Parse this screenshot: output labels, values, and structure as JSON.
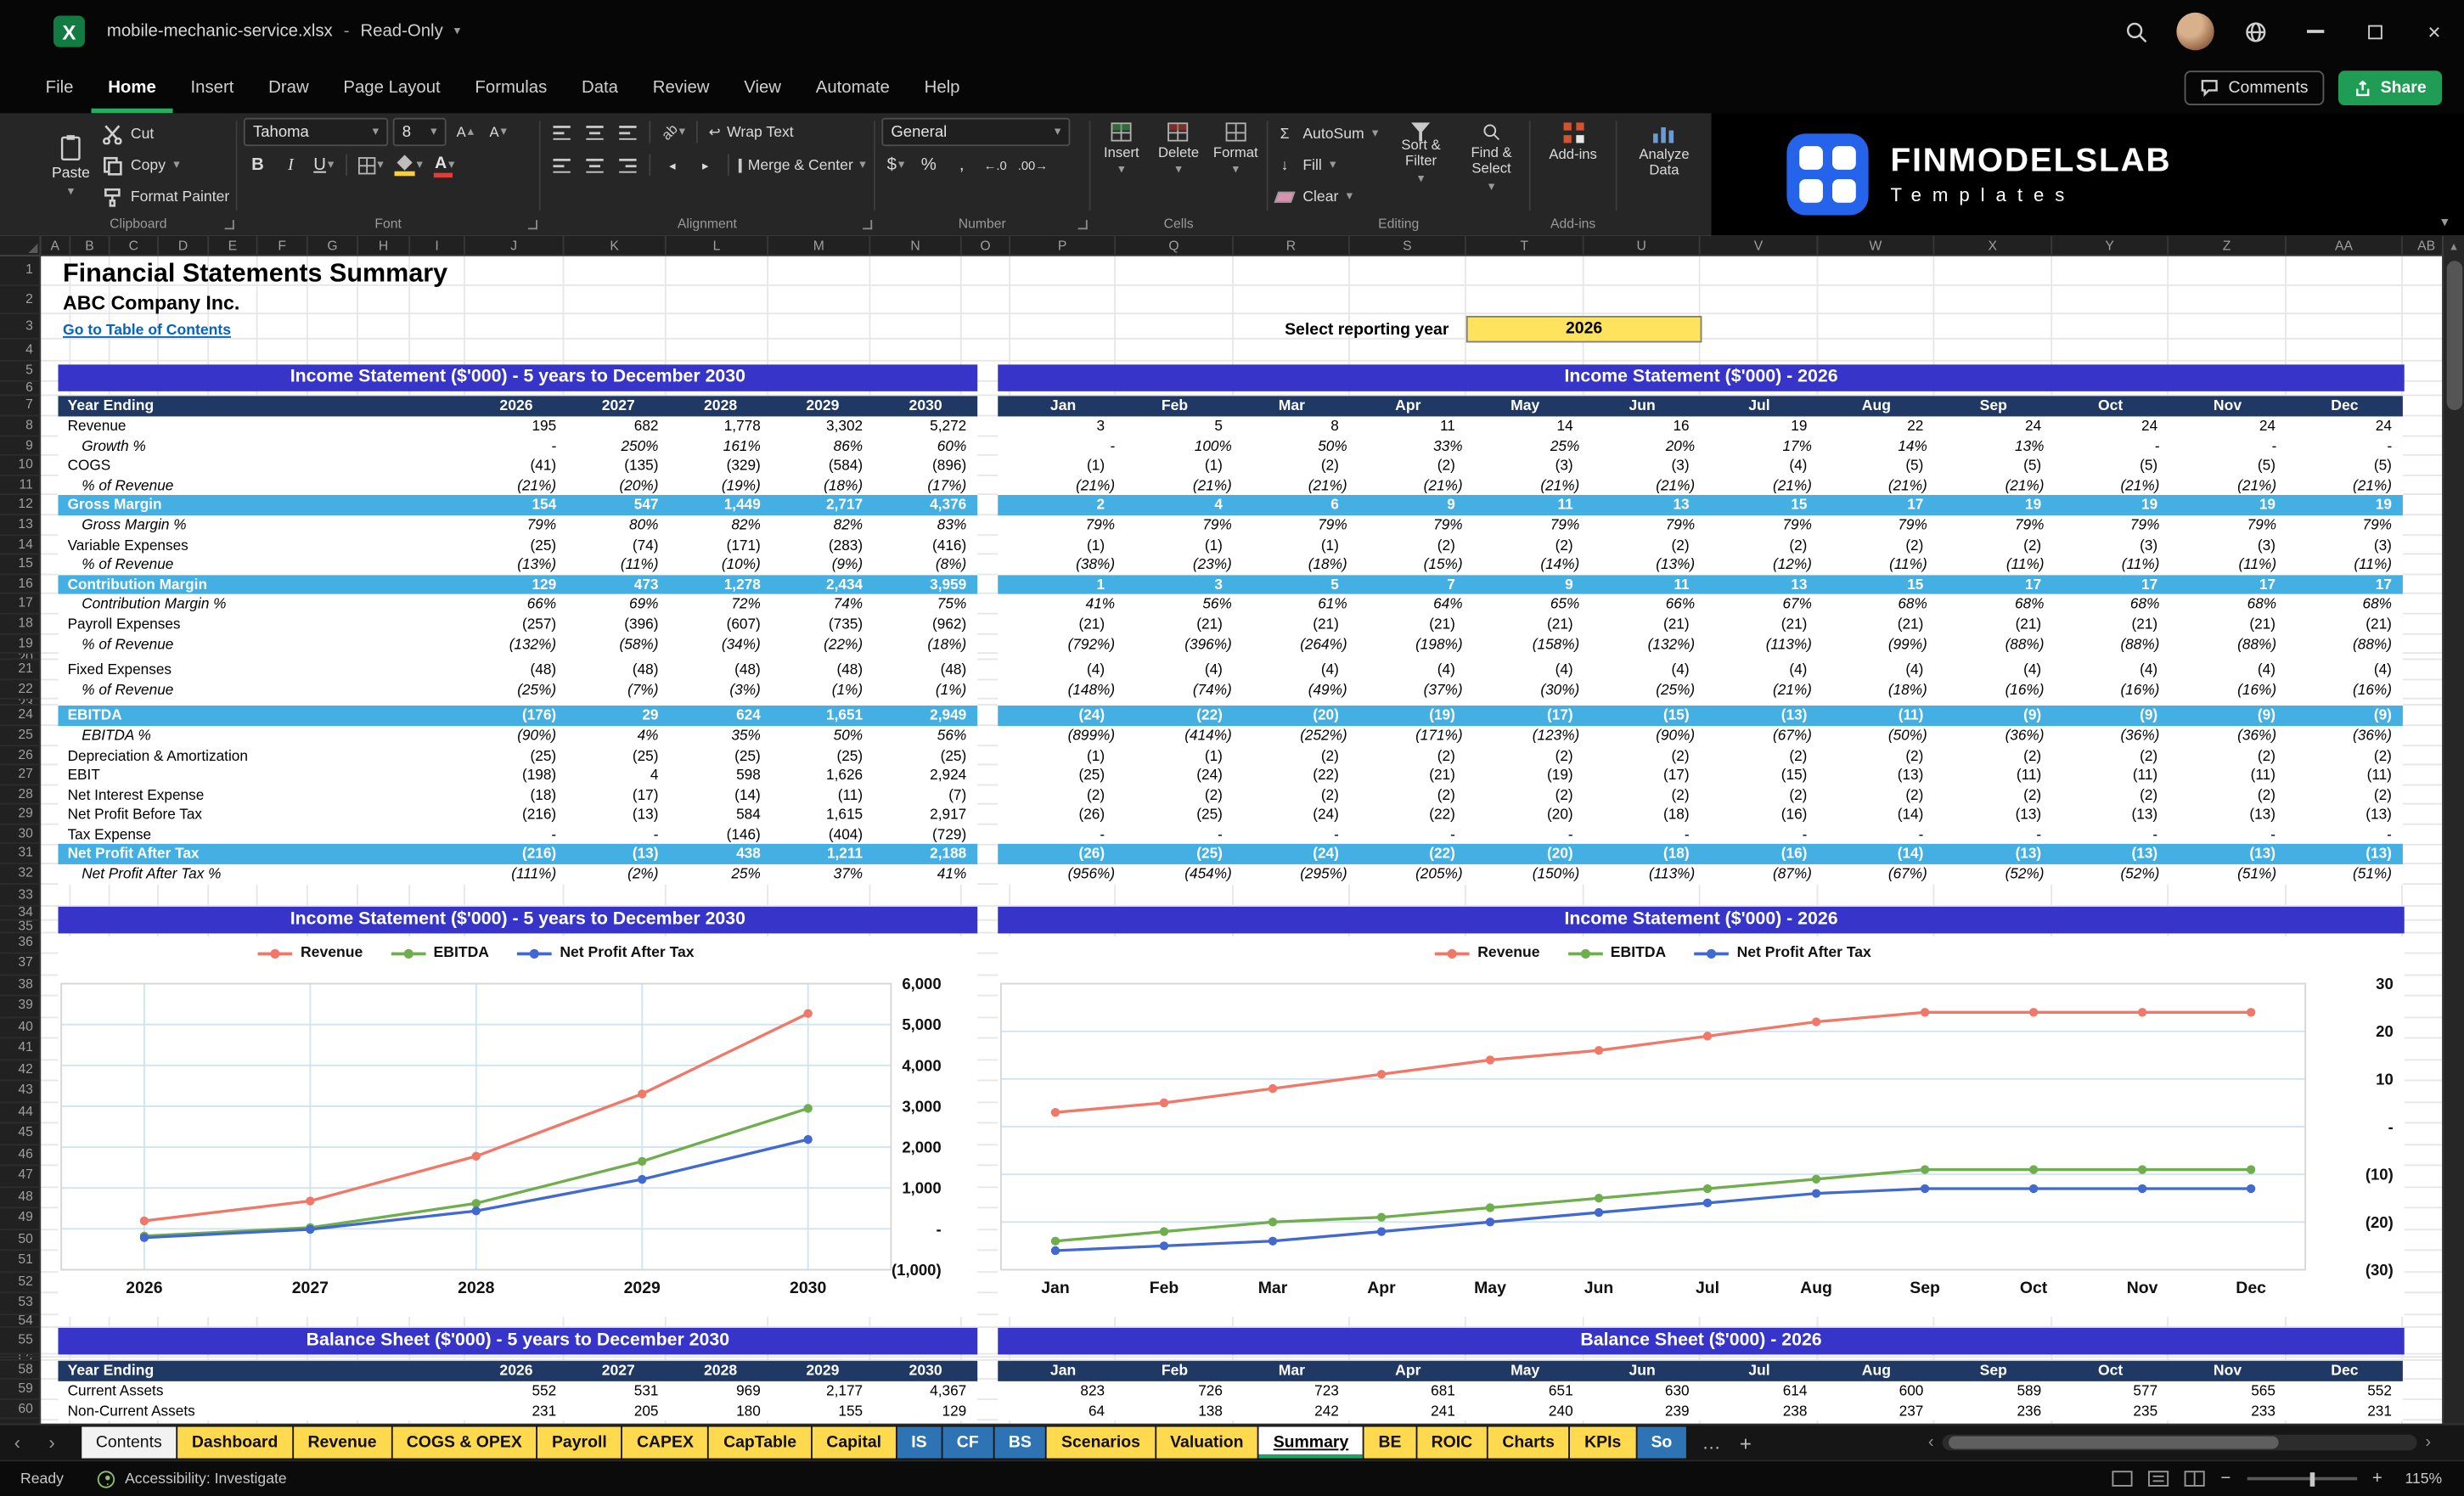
{
  "titlebar": {
    "filename": "mobile-mechanic-service.xlsx",
    "dash": "-",
    "mode": "Read-Only"
  },
  "menu": {
    "tabs": [
      "File",
      "Home",
      "Insert",
      "Draw",
      "Page Layout",
      "Formulas",
      "Data",
      "Review",
      "View",
      "Automate",
      "Help"
    ],
    "active_tab": "Home",
    "comments": "Comments",
    "share": "Share"
  },
  "ribbon": {
    "paste": "Paste",
    "cut": "Cut",
    "copy": "Copy",
    "format_painter": "Format Painter",
    "clipboard": "Clipboard",
    "font_name": "Tahoma",
    "font_size": "8",
    "font": "Font",
    "wrap_text": "Wrap Text",
    "merge_center": "Merge & Center",
    "alignment": "Alignment",
    "number_format": "General",
    "number": "Number",
    "insert": "Insert",
    "delete": "Delete",
    "format": "Format",
    "cells": "Cells",
    "autosum": "AutoSum",
    "fill": "Fill",
    "clear": "Clear",
    "sort_filter": "Sort & Filter",
    "find_select": "Find & Select",
    "editing": "Editing",
    "addins": "Add-ins",
    "analyze": "Analyze Data"
  },
  "icons": {
    "chevron_down": "▾",
    "chevron_up": "▴",
    "chevron_left": "‹",
    "chevron_right": "›",
    "bold": "B",
    "italic": "I",
    "underline": "U",
    "sigma": "Σ",
    "currency": "$",
    "percent": "%",
    "comma": ",",
    "inc_decimal": "←.0",
    "dec_decimal": ".00→",
    "fontA": "A",
    "orient": "ab",
    "wrap_arrow": "↩",
    "indent_dec": "◂",
    "indent_inc": "▸",
    "fill_down": "↓",
    "minus": "−",
    "plus": "+",
    "ellipsis": "…",
    "close": "×",
    "excel_x": "X"
  },
  "logo": {
    "brand": "FINMODELSLAB",
    "sub": "Templates"
  },
  "grid": {
    "columns": [
      "A",
      "B",
      "C",
      "D",
      "E",
      "F",
      "G",
      "H",
      "I",
      "J",
      "K",
      "L",
      "M",
      "N",
      "O",
      "P",
      "Q",
      "R",
      "S",
      "T",
      "U",
      "V",
      "W",
      "X",
      "Y",
      "Z",
      "AA",
      "AB"
    ],
    "rows": 60
  },
  "doc": {
    "title": "Financial Statements Summary",
    "company": "ABC Company Inc.",
    "link": "Go to Table of Contents",
    "select_label": "Select reporting year",
    "selected_year": "2026"
  },
  "sections": {
    "is_annual": "Income Statement ($'000) - 5 years to December 2030",
    "is_monthly": "Income Statement ($'000) - 2026",
    "bs_annual": "Balance Sheet ($'000) - 5 years to December 2030",
    "bs_monthly": "Balance Sheet ($'000) - 2026"
  },
  "tables": {
    "header_label": "Year Ending",
    "years": [
      "2026",
      "2027",
      "2028",
      "2029",
      "2030"
    ],
    "months": [
      "Jan",
      "Feb",
      "Mar",
      "Apr",
      "May",
      "Jun",
      "Jul",
      "Aug",
      "Sep",
      "Oct",
      "Nov",
      "Dec"
    ],
    "income_rows": [
      {
        "label": "Revenue",
        "style": "normal",
        "annual": [
          "195",
          "682",
          "1,778",
          "3,302",
          "5,272"
        ],
        "monthly": [
          "3",
          "5",
          "8",
          "11",
          "14",
          "16",
          "19",
          "22",
          "24",
          "24",
          "24",
          "24"
        ]
      },
      {
        "label": "Growth %",
        "style": "pct",
        "annual": [
          "-",
          "250%",
          "161%",
          "86%",
          "60%"
        ],
        "monthly": [
          "-",
          "100%",
          "50%",
          "33%",
          "25%",
          "20%",
          "17%",
          "14%",
          "13%",
          "-",
          "-",
          "-"
        ]
      },
      {
        "label": "COGS",
        "style": "normal",
        "annual": [
          "(41)",
          "(135)",
          "(329)",
          "(584)",
          "(896)"
        ],
        "monthly": [
          "(1)",
          "(1)",
          "(2)",
          "(2)",
          "(3)",
          "(3)",
          "(4)",
          "(5)",
          "(5)",
          "(5)",
          "(5)",
          "(5)"
        ]
      },
      {
        "label": "% of Revenue",
        "style": "pct",
        "annual": [
          "(21%)",
          "(20%)",
          "(19%)",
          "(18%)",
          "(17%)"
        ],
        "monthly": [
          "(21%)",
          "(21%)",
          "(21%)",
          "(21%)",
          "(21%)",
          "(21%)",
          "(21%)",
          "(21%)",
          "(21%)",
          "(21%)",
          "(21%)",
          "(21%)"
        ]
      },
      {
        "label": "Gross Margin",
        "style": "highlight",
        "annual": [
          "154",
          "547",
          "1,449",
          "2,717",
          "4,376"
        ],
        "monthly": [
          "2",
          "4",
          "6",
          "9",
          "11",
          "13",
          "15",
          "17",
          "19",
          "19",
          "19",
          "19"
        ]
      },
      {
        "label": "Gross Margin %",
        "style": "pct",
        "annual": [
          "79%",
          "80%",
          "82%",
          "82%",
          "83%"
        ],
        "monthly": [
          "79%",
          "79%",
          "79%",
          "79%",
          "79%",
          "79%",
          "79%",
          "79%",
          "79%",
          "79%",
          "79%",
          "79%"
        ]
      },
      {
        "label": "Variable Expenses",
        "style": "normal",
        "annual": [
          "(25)",
          "(74)",
          "(171)",
          "(283)",
          "(416)"
        ],
        "monthly": [
          "(1)",
          "(1)",
          "(1)",
          "(2)",
          "(2)",
          "(2)",
          "(2)",
          "(2)",
          "(2)",
          "(3)",
          "(3)",
          "(3)"
        ]
      },
      {
        "label": "% of Revenue",
        "style": "pct",
        "annual": [
          "(13%)",
          "(11%)",
          "(10%)",
          "(9%)",
          "(8%)"
        ],
        "monthly": [
          "(38%)",
          "(23%)",
          "(18%)",
          "(15%)",
          "(14%)",
          "(13%)",
          "(12%)",
          "(11%)",
          "(11%)",
          "(11%)",
          "(11%)",
          "(11%)"
        ]
      },
      {
        "label": "Contribution Margin",
        "style": "highlight",
        "annual": [
          "129",
          "473",
          "1,278",
          "2,434",
          "3,959"
        ],
        "monthly": [
          "1",
          "3",
          "5",
          "7",
          "9",
          "11",
          "13",
          "15",
          "17",
          "17",
          "17",
          "17"
        ]
      },
      {
        "label": "Contribution Margin %",
        "style": "pct",
        "annual": [
          "66%",
          "69%",
          "72%",
          "74%",
          "75%"
        ],
        "monthly": [
          "41%",
          "56%",
          "61%",
          "64%",
          "65%",
          "66%",
          "67%",
          "68%",
          "68%",
          "68%",
          "68%",
          "68%"
        ]
      },
      {
        "label": "Payroll Expenses",
        "style": "normal",
        "annual": [
          "(257)",
          "(396)",
          "(607)",
          "(735)",
          "(962)"
        ],
        "monthly": [
          "(21)",
          "(21)",
          "(21)",
          "(21)",
          "(21)",
          "(21)",
          "(21)",
          "(21)",
          "(21)",
          "(21)",
          "(21)",
          "(21)"
        ]
      },
      {
        "label": "% of Revenue",
        "style": "pct",
        "annual": [
          "(132%)",
          "(58%)",
          "(34%)",
          "(22%)",
          "(18%)"
        ],
        "monthly": [
          "(792%)",
          "(396%)",
          "(264%)",
          "(198%)",
          "(158%)",
          "(132%)",
          "(113%)",
          "(99%)",
          "(88%)",
          "(88%)",
          "(88%)",
          "(88%)"
        ]
      },
      {
        "label": "Fixed Expenses",
        "style": "normal",
        "annual": [
          "(48)",
          "(48)",
          "(48)",
          "(48)",
          "(48)"
        ],
        "monthly": [
          "(4)",
          "(4)",
          "(4)",
          "(4)",
          "(4)",
          "(4)",
          "(4)",
          "(4)",
          "(4)",
          "(4)",
          "(4)",
          "(4)"
        ]
      },
      {
        "label": "% of Revenue",
        "style": "pct",
        "annual": [
          "(25%)",
          "(7%)",
          "(3%)",
          "(1%)",
          "(1%)"
        ],
        "monthly": [
          "(148%)",
          "(74%)",
          "(49%)",
          "(37%)",
          "(30%)",
          "(25%)",
          "(21%)",
          "(18%)",
          "(16%)",
          "(16%)",
          "(16%)",
          "(16%)"
        ]
      },
      {
        "label": "EBITDA",
        "style": "highlight",
        "annual": [
          "(176)",
          "29",
          "624",
          "1,651",
          "2,949"
        ],
        "monthly": [
          "(24)",
          "(22)",
          "(20)",
          "(19)",
          "(17)",
          "(15)",
          "(13)",
          "(11)",
          "(9)",
          "(9)",
          "(9)",
          "(9)"
        ]
      },
      {
        "label": "EBITDA %",
        "style": "pct",
        "annual": [
          "(90%)",
          "4%",
          "35%",
          "50%",
          "56%"
        ],
        "monthly": [
          "(899%)",
          "(414%)",
          "(252%)",
          "(171%)",
          "(123%)",
          "(90%)",
          "(67%)",
          "(50%)",
          "(36%)",
          "(36%)",
          "(36%)",
          "(36%)"
        ]
      },
      {
        "label": "Depreciation & Amortization",
        "style": "normal",
        "annual": [
          "(25)",
          "(25)",
          "(25)",
          "(25)",
          "(25)"
        ],
        "monthly": [
          "(1)",
          "(1)",
          "(2)",
          "(2)",
          "(2)",
          "(2)",
          "(2)",
          "(2)",
          "(2)",
          "(2)",
          "(2)",
          "(2)"
        ]
      },
      {
        "label": "EBIT",
        "style": "normal",
        "annual": [
          "(198)",
          "4",
          "598",
          "1,626",
          "2,924"
        ],
        "monthly": [
          "(25)",
          "(24)",
          "(22)",
          "(21)",
          "(19)",
          "(17)",
          "(15)",
          "(13)",
          "(11)",
          "(11)",
          "(11)",
          "(11)"
        ]
      },
      {
        "label": "Net Interest Expense",
        "style": "normal",
        "annual": [
          "(18)",
          "(17)",
          "(14)",
          "(11)",
          "(7)"
        ],
        "monthly": [
          "(2)",
          "(2)",
          "(2)",
          "(2)",
          "(2)",
          "(2)",
          "(2)",
          "(2)",
          "(2)",
          "(2)",
          "(2)",
          "(2)"
        ]
      },
      {
        "label": "Net Profit Before Tax",
        "style": "normal",
        "annual": [
          "(216)",
          "(13)",
          "584",
          "1,615",
          "2,917"
        ],
        "monthly": [
          "(26)",
          "(25)",
          "(24)",
          "(22)",
          "(20)",
          "(18)",
          "(16)",
          "(14)",
          "(13)",
          "(13)",
          "(13)",
          "(13)"
        ]
      },
      {
        "label": "Tax Expense",
        "style": "normal",
        "annual": [
          "-",
          "-",
          "(146)",
          "(404)",
          "(729)"
        ],
        "monthly": [
          "-",
          "-",
          "-",
          "-",
          "-",
          "-",
          "-",
          "-",
          "-",
          "-",
          "-",
          "-"
        ]
      },
      {
        "label": "Net Profit After Tax",
        "style": "highlight",
        "annual": [
          "(216)",
          "(13)",
          "438",
          "1,211",
          "2,188"
        ],
        "monthly": [
          "(26)",
          "(25)",
          "(24)",
          "(22)",
          "(20)",
          "(18)",
          "(16)",
          "(14)",
          "(13)",
          "(13)",
          "(13)",
          "(13)"
        ]
      },
      {
        "label": "Net Profit After Tax %",
        "style": "pct",
        "annual": [
          "(111%)",
          "(2%)",
          "25%",
          "37%",
          "41%"
        ],
        "monthly": [
          "(956%)",
          "(454%)",
          "(295%)",
          "(205%)",
          "(150%)",
          "(113%)",
          "(87%)",
          "(67%)",
          "(52%)",
          "(52%)",
          "(51%)",
          "(51%)"
        ]
      }
    ],
    "balance_rows": [
      {
        "label": "Current Assets",
        "style": "normal",
        "annual": [
          "552",
          "531",
          "969",
          "2,177",
          "4,367"
        ],
        "monthly": [
          "823",
          "726",
          "723",
          "681",
          "651",
          "630",
          "614",
          "600",
          "589",
          "577",
          "565",
          "552"
        ]
      },
      {
        "label": "Non-Current Assets",
        "style": "normal",
        "annual": [
          "231",
          "205",
          "180",
          "155",
          "129"
        ],
        "monthly": [
          "64",
          "138",
          "242",
          "241",
          "240",
          "239",
          "238",
          "237",
          "236",
          "235",
          "233",
          "231"
        ]
      }
    ]
  },
  "chart_data": [
    {
      "type": "line",
      "title": "Income Statement ($'000) - 5 years to December 2030",
      "x": [
        "2026",
        "2027",
        "2028",
        "2029",
        "2030"
      ],
      "series": [
        {
          "name": "Revenue",
          "color": "#F07868",
          "values": [
            195,
            682,
            1778,
            3302,
            5272
          ]
        },
        {
          "name": "EBITDA",
          "color": "#6FAE4C",
          "values": [
            -176,
            29,
            624,
            1651,
            2949
          ]
        },
        {
          "name": "Net Profit After Tax",
          "color": "#4169D0",
          "values": [
            -216,
            -13,
            438,
            1211,
            2188
          ]
        }
      ],
      "ylim": [
        -1000,
        6000
      ],
      "ystep": 1000,
      "ytick_labels": [
        "6,000",
        "5,000",
        "4,000",
        "3,000",
        "2,000",
        "1,000",
        "-",
        "(1,000)"
      ],
      "legend_position": "top",
      "grid": true,
      "vertical_grid": true
    },
    {
      "type": "line",
      "title": "Income Statement ($'000) - 2026",
      "x": [
        "Jan",
        "Feb",
        "Mar",
        "Apr",
        "May",
        "Jun",
        "Jul",
        "Aug",
        "Sep",
        "Oct",
        "Nov",
        "Dec"
      ],
      "series": [
        {
          "name": "Revenue",
          "color": "#F07868",
          "values": [
            3,
            5,
            8,
            11,
            14,
            16,
            19,
            22,
            24,
            24,
            24,
            24
          ]
        },
        {
          "name": "EBITDA",
          "color": "#6FAE4C",
          "values": [
            -24,
            -22,
            -20,
            -19,
            -17,
            -15,
            -13,
            -11,
            -9,
            -9,
            -9,
            -9
          ]
        },
        {
          "name": "Net Profit After Tax",
          "color": "#4169D0",
          "values": [
            -26,
            -25,
            -24,
            -22,
            -20,
            -18,
            -16,
            -14,
            -13,
            -13,
            -13,
            -13
          ]
        }
      ],
      "ylim": [
        -30,
        30
      ],
      "ystep": 10,
      "ytick_labels": [
        "30",
        "20",
        "10",
        "-",
        "(10)",
        "(20)",
        "(30)"
      ],
      "legend_position": "top",
      "grid": true,
      "vertical_grid": false
    }
  ],
  "sheet_tabs": [
    {
      "label": "Contents",
      "color": "white"
    },
    {
      "label": "Dashboard",
      "color": "yellow"
    },
    {
      "label": "Revenue",
      "color": "yellow"
    },
    {
      "label": "COGS & OPEX",
      "color": "yellow"
    },
    {
      "label": "Payroll",
      "color": "yellow"
    },
    {
      "label": "CAPEX",
      "color": "yellow"
    },
    {
      "label": "CapTable",
      "color": "yellow"
    },
    {
      "label": "Capital",
      "color": "yellow"
    },
    {
      "label": "IS",
      "color": "blue"
    },
    {
      "label": "CF",
      "color": "blue"
    },
    {
      "label": "BS",
      "color": "blue"
    },
    {
      "label": "Scenarios",
      "color": "yellow"
    },
    {
      "label": "Valuation",
      "color": "yellow"
    },
    {
      "label": "Summary",
      "color": "white",
      "active": true
    },
    {
      "label": "BE",
      "color": "yellow"
    },
    {
      "label": "ROIC",
      "color": "yellow"
    },
    {
      "label": "Charts",
      "color": "yellow"
    },
    {
      "label": "KPIs",
      "color": "yellow"
    },
    {
      "label": "So",
      "color": "blue"
    }
  ],
  "status": {
    "ready": "Ready",
    "accessibility": "Accessibility: Investigate",
    "zoom": "115%"
  },
  "colors": {
    "banner": "#3735C9",
    "table_header": "#1F3864",
    "highlight_row": "#43AFE3",
    "tab_yellow": "#FFD94E",
    "tab_blue": "#2E74B5",
    "accent_green": "#21A366",
    "select_cell": "#FFE35C",
    "revenue": "#F07868",
    "ebitda": "#6FAE4C",
    "npat": "#4169D0"
  }
}
